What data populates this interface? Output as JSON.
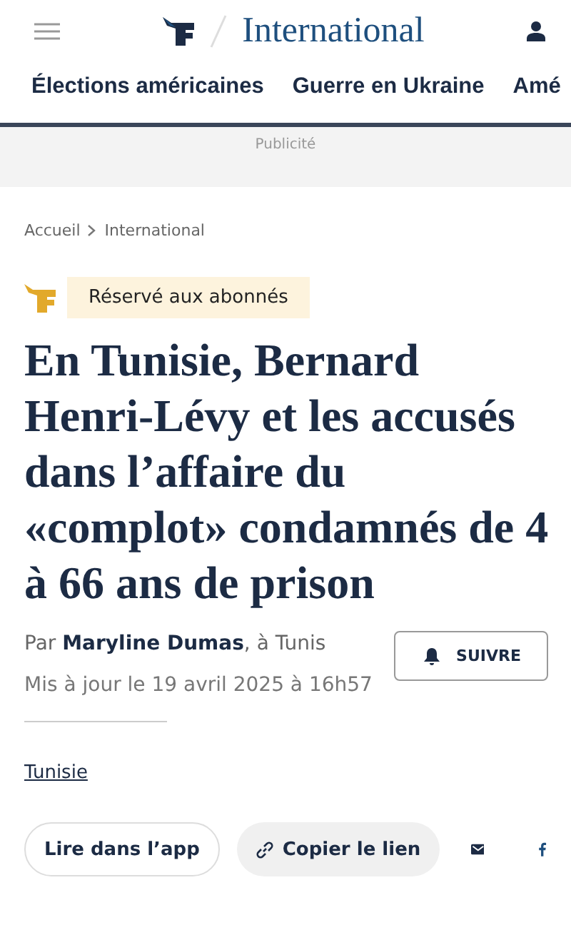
{
  "header": {
    "section": "International"
  },
  "nav": {
    "items": [
      {
        "label": "Élections américaines"
      },
      {
        "label": "Guerre en Ukraine"
      },
      {
        "label": "Amé"
      }
    ]
  },
  "ad": {
    "label": "Publicité"
  },
  "breadcrumb": [
    "Accueil",
    "International"
  ],
  "badge": "Réservé aux abonnés",
  "title": "En Tunisie, Bernard Henri-Lévy et les accusés dans l’affaire du «complot» condamnés de 4 à 66 ans de prison",
  "byline": "Par **Maryline Dumas**, à Tunis",
  "updated": "Mis à jour le 19 avril 2025 à 16h57",
  "follow": "SUIVRE",
  "tag": "Tunisie",
  "actions": {
    "app": "Lire dans l’app",
    "copy": "Copier le lien"
  }
}
